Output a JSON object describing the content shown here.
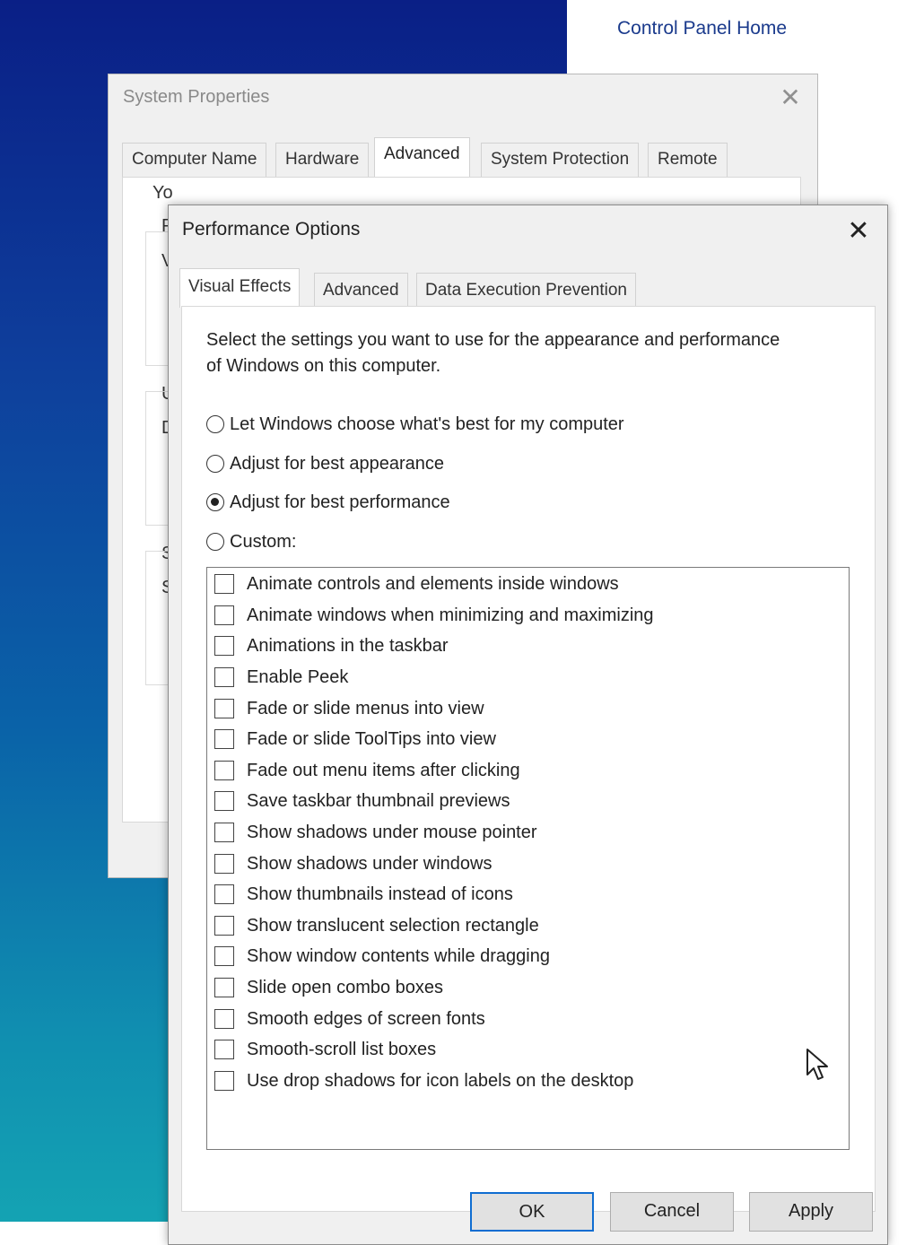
{
  "background": {
    "control_panel_link": "Control Panel Home"
  },
  "system_properties": {
    "title": "System Properties",
    "close_glyph": "✕",
    "tabs": [
      "Computer Name",
      "Hardware",
      "Advanced",
      "System Protection",
      "Remote"
    ],
    "active_tab": "Advanced",
    "partial_text": [
      "Yo",
      "P",
      "V",
      "U",
      "D",
      "S",
      "S"
    ]
  },
  "performance_options": {
    "title": "Performance Options",
    "close_glyph": "✕",
    "tabs": [
      "Visual Effects",
      "Advanced",
      "Data Execution Prevention"
    ],
    "active_tab": "Visual Effects",
    "description": "Select the settings you want to use for the appearance and performance of Windows on this computer.",
    "radios": [
      {
        "label": "Let Windows choose what's best for my computer",
        "checked": false
      },
      {
        "label": "Adjust for best appearance",
        "checked": false
      },
      {
        "label": "Adjust for best performance",
        "checked": true
      },
      {
        "label": "Custom:",
        "checked": false
      }
    ],
    "effects": [
      "Animate controls and elements inside windows",
      "Animate windows when minimizing and maximizing",
      "Animations in the taskbar",
      "Enable Peek",
      "Fade or slide menus into view",
      "Fade or slide ToolTips into view",
      "Fade out menu items after clicking",
      "Save taskbar thumbnail previews",
      "Show shadows under mouse pointer",
      "Show shadows under windows",
      "Show thumbnails instead of icons",
      "Show translucent selection rectangle",
      "Show window contents while dragging",
      "Slide open combo boxes",
      "Smooth edges of screen fonts",
      "Smooth-scroll list boxes",
      "Use drop shadows for icon labels on the desktop"
    ],
    "buttons": {
      "ok": "OK",
      "cancel": "Cancel",
      "apply": "Apply"
    },
    "accent_color": "#0f6dd1"
  },
  "icons": {
    "cursor": "mouse-pointer-icon",
    "close": "close-icon"
  }
}
